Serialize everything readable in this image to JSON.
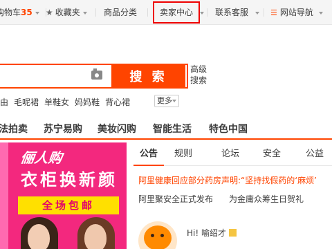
{
  "topbar": {
    "cart_label": "购物车",
    "cart_count": "35",
    "favorites_label": "收藏夹",
    "category_label": "商品分类",
    "seller_center_label": "卖家中心",
    "customer_service_label": "联系客服",
    "site_nav_label": "网站导航"
  },
  "search": {
    "placeholder": "",
    "button_label": "搜 索",
    "advanced_line1": "高级",
    "advanced_line2": "搜索"
  },
  "hotwords": {
    "items": [
      "由",
      "毛呢裙",
      "单鞋女",
      "妈妈鞋",
      "背心裙"
    ],
    "more_label": "更多"
  },
  "category_nav": {
    "items": [
      "法拍卖",
      "苏宁易购",
      "美妆闪购",
      "智能生活",
      "特色中国"
    ]
  },
  "banner": {
    "brand": "俪人购",
    "headline": "衣柜换新颜",
    "badge": "全场包邮"
  },
  "notice": {
    "tabs": [
      "公告",
      "规则",
      "论坛",
      "安全",
      "公益"
    ],
    "active_tab": "公告",
    "headline_1": "阿里健康回应部分药房声明:“坚持找假药的‘麻烦’",
    "item_2": "阿里聚安全正式发布",
    "item_3": "为金庸众筹生日贺礼"
  },
  "user": {
    "greeting": "Hi! 喻绍才"
  },
  "colors": {
    "accent": "#ff4400",
    "banner_bg": "#f3287e",
    "highlight_box": "#e00000"
  }
}
